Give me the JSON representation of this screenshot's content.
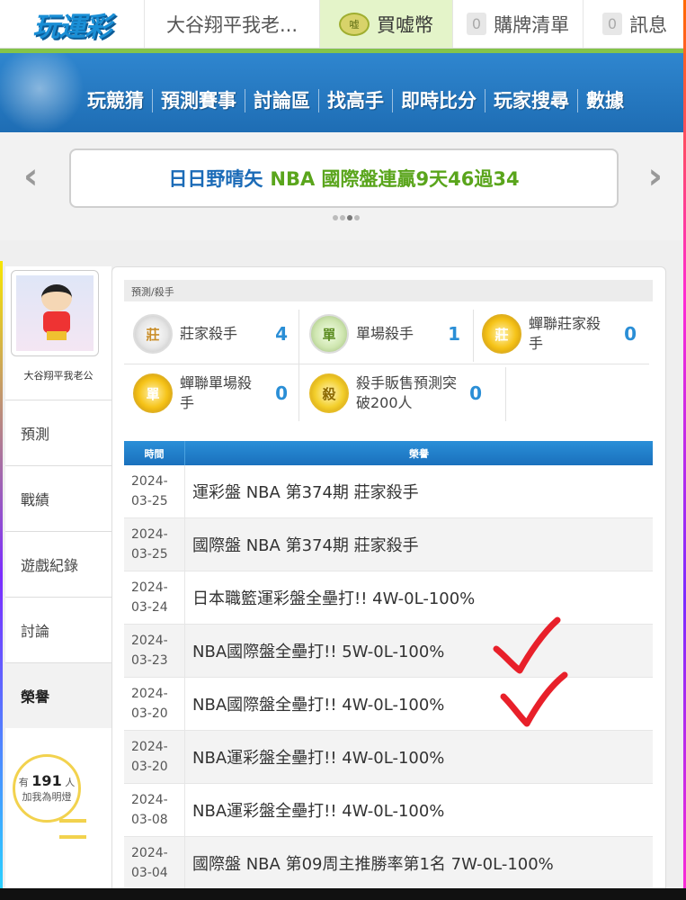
{
  "topbar": {
    "logo": "玩運彩",
    "user": "大谷翔平我老...",
    "coin_icon": "嘘",
    "buy_coins": "買嘘幣",
    "cart_count": "0",
    "cart": "購牌清單",
    "msg_count": "0",
    "messages": "訊息"
  },
  "nav": [
    "玩競猜",
    "預測賽事",
    "討論區",
    "找高手",
    "即時比分",
    "玩家搜尋",
    "數據"
  ],
  "banner": {
    "name": "日日野晴矢",
    "text": "NBA 國際盤連贏9天46過34",
    "prev": "‹",
    "next": "›"
  },
  "sidebar": {
    "username": "大谷翔平我老公",
    "items": [
      "預測",
      "戰績",
      "遊戲紀錄",
      "討論",
      "榮譽"
    ],
    "likes_prefix": "有",
    "likes_count": "191",
    "likes_suffix": "人",
    "likes_line2": "加我為明燈"
  },
  "breadcrumb": "預測/殺手",
  "honors": [
    {
      "icon": "莊",
      "label": "莊家殺手",
      "value": "4",
      "color": "#2a8ed6"
    },
    {
      "icon": "單",
      "label": "單場殺手",
      "value": "1",
      "color": "#2a8ed6"
    },
    {
      "icon": "莊",
      "label": "蟬聯莊家殺手",
      "value": "0",
      "color": "#2a8ed6"
    },
    {
      "icon": "單",
      "label": "蟬聯單場殺手",
      "value": "0",
      "color": "#2a8ed6"
    },
    {
      "icon": "殺",
      "label": "殺手販售預測突破200人",
      "value": "0",
      "color": "#2a8ed6"
    }
  ],
  "table": {
    "headers": [
      "時間",
      "榮譽"
    ],
    "rows": [
      {
        "date_y": "2024-",
        "date_md": "03-25",
        "honor": "運彩盤 NBA 第374期 莊家殺手"
      },
      {
        "date_y": "2024-",
        "date_md": "03-25",
        "honor": "國際盤 NBA 第374期 莊家殺手"
      },
      {
        "date_y": "2024-",
        "date_md": "03-24",
        "honor": "日本職籃運彩盤全壘打!! 4W-0L-100%"
      },
      {
        "date_y": "2024-",
        "date_md": "03-23",
        "honor": "NBA國際盤全壘打!! 5W-0L-100%"
      },
      {
        "date_y": "2024-",
        "date_md": "03-20",
        "honor": "NBA國際盤全壘打!! 4W-0L-100%"
      },
      {
        "date_y": "2024-",
        "date_md": "03-20",
        "honor": "NBA運彩盤全壘打!! 4W-0L-100%"
      },
      {
        "date_y": "2024-",
        "date_md": "03-08",
        "honor": "NBA運彩盤全壘打!! 4W-0L-100%"
      },
      {
        "date_y": "2024-",
        "date_md": "03-04",
        "honor": "國際盤 NBA 第09周主推勝率第1名 7W-0L-100%"
      }
    ]
  },
  "annotations": {
    "check_color": "#e8202a"
  }
}
